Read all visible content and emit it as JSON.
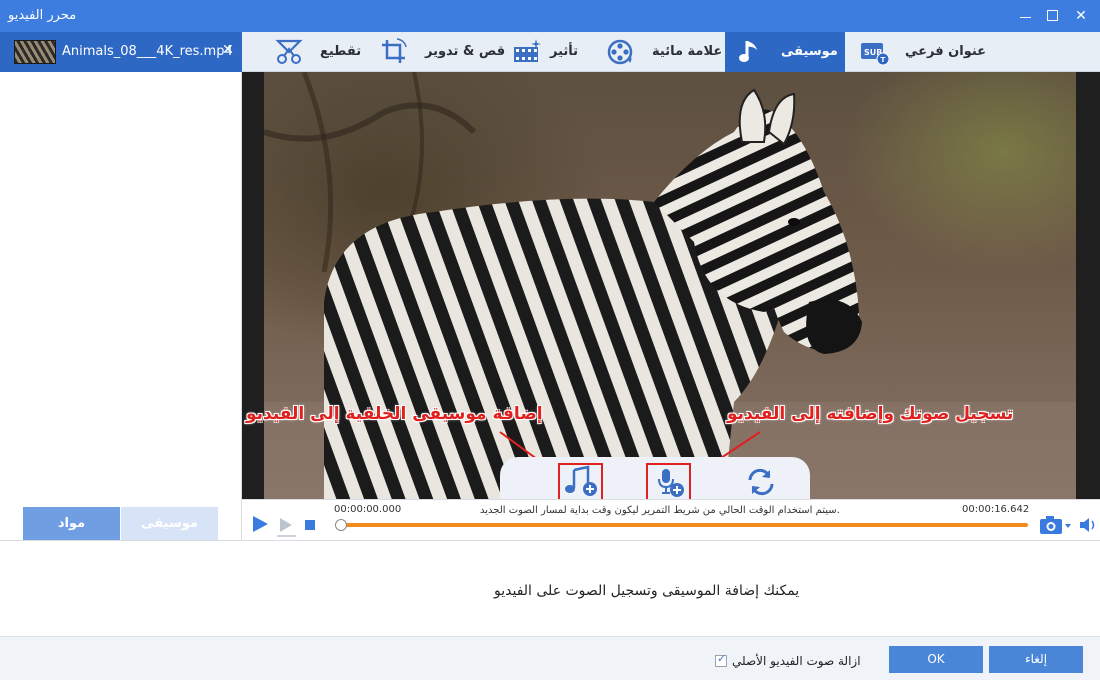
{
  "window": {
    "title": "محرر الفيديو",
    "close_glyph": "✕"
  },
  "file_tab": {
    "name": "Animals_08___4K_res.mp4",
    "close_glyph": "✕"
  },
  "toolbar": {
    "tabs": [
      {
        "label": "عنوان فرعي",
        "icon": "subtitle-icon"
      },
      {
        "label": "موسيقى",
        "icon": "music-note-icon",
        "active": true
      },
      {
        "label": "علامة مائية",
        "icon": "film-reel-icon"
      },
      {
        "label": "تأثير",
        "icon": "film-effect-icon"
      },
      {
        "label": "قص & تدوير",
        "icon": "crop-rotate-icon"
      },
      {
        "label": "تقطيع",
        "icon": "scissors-icon"
      }
    ]
  },
  "annotations": {
    "bg_music": "إضافة موسيقى الخلفية إلى الفيديو",
    "record_voice": "تسجيل صوتك وإضافته إلى الفيديو"
  },
  "playback": {
    "time_start": "00:00:00.000",
    "time_end": "00:00:16.642",
    "hint": "سيتم استخدام الوقت الحالي من شريط التمرير ليكون وقت بداية لمسار الصوت الجديد.",
    "progress": 0
  },
  "left_tabs": {
    "materials": "مواد",
    "music": "موسيقى"
  },
  "info": {
    "message": "يمكنك إضافة الموسيقى وتسجيل الصوت على الفيديو"
  },
  "footer": {
    "remove_audio_label": "ازالة صوت الفيديو الأصلي",
    "remove_audio_checked": true,
    "ok_label": "OK",
    "cancel_label": "إلغاء"
  },
  "colors": {
    "accent": "#2d68c4",
    "title_bar": "#3d7de0",
    "progress": "#f28a1c",
    "annotation": "#e0211f"
  }
}
